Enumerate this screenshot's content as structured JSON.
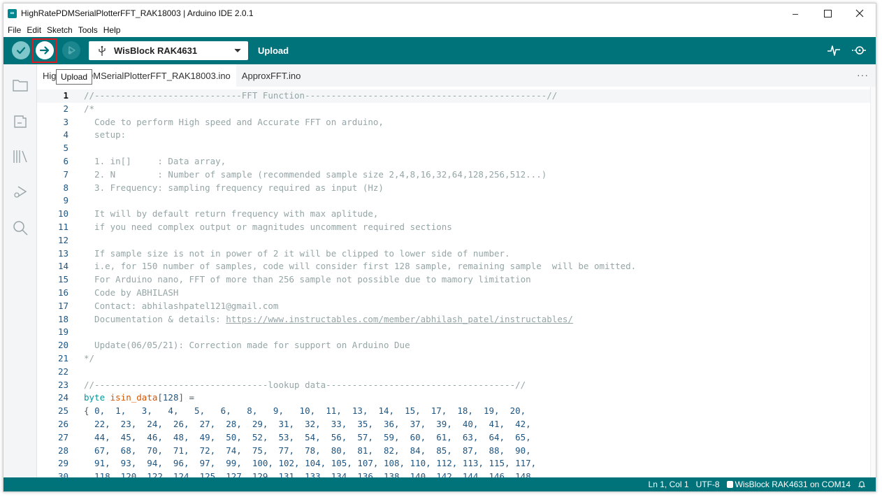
{
  "window": {
    "title": "HighRatePDMSerialPlotterFFT_RAK18003 | Arduino IDE 2.0.1",
    "app_icon_glyph": "∞",
    "controls": {
      "minimize": "–",
      "maximize": "☐",
      "close": "✕"
    }
  },
  "menu": [
    "File",
    "Edit",
    "Sketch",
    "Tools",
    "Help"
  ],
  "toolbar": {
    "board": "WisBlock RAK4631",
    "hover_label": "Upload",
    "icons": [
      "verify-icon",
      "upload-icon",
      "debug-icon",
      "usb-icon",
      "serial-plotter-icon",
      "serial-monitor-icon"
    ],
    "accent_color": "#00727a",
    "highlight_color": "#e3191f"
  },
  "tooltip": "Upload",
  "tabs": [
    {
      "label": "HighRatePDMSerialPlotterFFT_RAK18003.ino",
      "active": true
    },
    {
      "label": "ApproxFFT.ino",
      "active": false
    }
  ],
  "tab_more": "···",
  "sidebar_icons": [
    "sketchbook-icon",
    "boards-manager-icon",
    "library-manager-icon",
    "debug-icon",
    "search-icon"
  ],
  "editor": {
    "current_line": 1,
    "lines": [
      {
        "n": "1",
        "t": [
          [
            "c-comment",
            "//----------------------------FFT Function----------------------------------------------//"
          ]
        ]
      },
      {
        "n": "2",
        "t": [
          [
            "c-comment",
            "/*"
          ]
        ]
      },
      {
        "n": "3",
        "t": [
          [
            "c-comment",
            "  Code to perform High speed and Accurate FFT on arduino,"
          ]
        ]
      },
      {
        "n": "4",
        "t": [
          [
            "c-comment",
            "  setup:"
          ]
        ]
      },
      {
        "n": "5",
        "t": [
          [
            "c-comment",
            ""
          ]
        ]
      },
      {
        "n": "6",
        "t": [
          [
            "c-comment",
            "  1. in[]     : Data array,"
          ]
        ]
      },
      {
        "n": "7",
        "t": [
          [
            "c-comment",
            "  2. N        : Number of sample (recommended sample size 2,4,8,16,32,64,128,256,512...)"
          ]
        ]
      },
      {
        "n": "8",
        "t": [
          [
            "c-comment",
            "  3. Frequency: sampling frequency required as input (Hz)"
          ]
        ]
      },
      {
        "n": "9",
        "t": [
          [
            "c-comment",
            ""
          ]
        ]
      },
      {
        "n": "10",
        "t": [
          [
            "c-comment",
            "  It will by default return frequency with max aplitude,"
          ]
        ]
      },
      {
        "n": "11",
        "t": [
          [
            "c-comment",
            "  if you need complex output or magnitudes uncomment required sections"
          ]
        ]
      },
      {
        "n": "12",
        "t": [
          [
            "c-comment",
            ""
          ]
        ]
      },
      {
        "n": "13",
        "t": [
          [
            "c-comment",
            "  If sample size is not in power of 2 it will be clipped to lower side of number."
          ]
        ]
      },
      {
        "n": "14",
        "t": [
          [
            "c-comment",
            "  i.e, for 150 number of samples, code will consider first 128 sample, remaining sample  will be omitted."
          ]
        ]
      },
      {
        "n": "15",
        "t": [
          [
            "c-comment",
            "  For Arduino nano, FFT of more than 256 sample not possible due to mamory limitation"
          ]
        ]
      },
      {
        "n": "16",
        "t": [
          [
            "c-comment",
            "  Code by ABHILASH"
          ]
        ]
      },
      {
        "n": "17",
        "t": [
          [
            "c-comment",
            "  Contact: abhilashpatel121@gmail.com"
          ]
        ]
      },
      {
        "n": "18",
        "t": [
          [
            "c-comment",
            "  Documentation & details: "
          ],
          [
            "c-link",
            "https://www.instructables.com/member/abhilash_patel/instructables/"
          ]
        ]
      },
      {
        "n": "19",
        "t": [
          [
            "c-comment",
            ""
          ]
        ]
      },
      {
        "n": "20",
        "t": [
          [
            "c-comment",
            "  Update(06/05/21): Correction made for support on Arduino Due"
          ]
        ]
      },
      {
        "n": "21",
        "t": [
          [
            "c-comment",
            "*/"
          ]
        ]
      },
      {
        "n": "22",
        "t": [
          [
            "c-plain",
            ""
          ]
        ]
      },
      {
        "n": "23",
        "t": [
          [
            "c-comment",
            "//---------------------------------lookup data------------------------------------//"
          ]
        ]
      },
      {
        "n": "24",
        "t": [
          [
            "c-type",
            "byte "
          ],
          [
            "c-name",
            "isin_data"
          ],
          [
            "c-plain",
            "["
          ],
          [
            "c-num",
            "128"
          ],
          [
            "c-plain",
            "] ="
          ]
        ]
      },
      {
        "n": "25",
        "t": [
          [
            "c-plain",
            "{ "
          ],
          [
            "c-num",
            "0,  1,   3,   4,   5,   6,   8,   9,   10,  11,  13,  14,  15,  17,  18,  19,  20,"
          ]
        ]
      },
      {
        "n": "26",
        "t": [
          [
            "c-num",
            "  22,  23,  24,  26,  27,  28,  29,  31,  32,  33,  35,  36,  37,  39,  40,  41,  42,"
          ]
        ]
      },
      {
        "n": "27",
        "t": [
          [
            "c-num",
            "  44,  45,  46,  48,  49,  50,  52,  53,  54,  56,  57,  59,  60,  61,  63,  64,  65,"
          ]
        ]
      },
      {
        "n": "28",
        "t": [
          [
            "c-num",
            "  67,  68,  70,  71,  72,  74,  75,  77,  78,  80,  81,  82,  84,  85,  87,  88,  90,"
          ]
        ]
      },
      {
        "n": "29",
        "t": [
          [
            "c-num",
            "  91,  93,  94,  96,  97,  99,  100, 102, 104, 105, 107, 108, 110, 112, 113, 115, 117,"
          ]
        ]
      },
      {
        "n": "30",
        "t": [
          [
            "c-num",
            "  118, 120, 122, 124, 125, 127, 129, 131, 133, 134, 136, 138, 140, 142, 144, 146, 148,"
          ]
        ]
      }
    ]
  },
  "status": {
    "position": "Ln 1, Col 1",
    "encoding": "UTF-8",
    "board_port": "WisBlock RAK4631 on COM14",
    "bell_icon": "bell-icon"
  }
}
